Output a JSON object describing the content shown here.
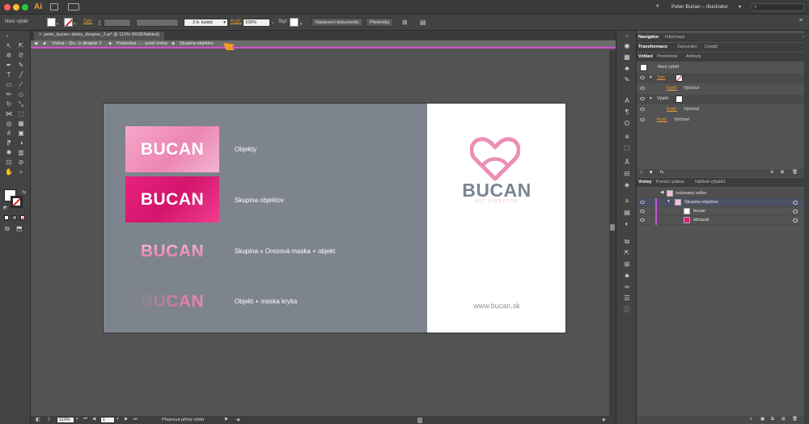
{
  "app": {
    "name": "Ai",
    "title": "Peter Bučan – Illustrator",
    "search_placeholder": ""
  },
  "control_bar": {
    "selection": "Není výběr",
    "stroke_label": "Tah:",
    "brush": "3 b. kulatý",
    "opacity_label": "Krytí:",
    "opacity_value": "100%",
    "style_label": "Styl:",
    "doc_setup_button": "Nastavení dokumentu",
    "prefs_button": "Předvolby"
  },
  "document": {
    "tab_title": "peter_bucan--dobry_dizajner_2.ai* @ 110% (RGB/Náhled)",
    "breadcrumb": [
      "Vrstva – Do...b dizajnér 2",
      "Podvrstva –... avod vrstvy",
      "Skupina objektov"
    ]
  },
  "artboard": {
    "rows": [
      {
        "logo_text": "BUCAN",
        "label": "Objekty"
      },
      {
        "logo_text": "BUCAN",
        "label": "Skupina objektov"
      },
      {
        "logo_text": "BUCAN",
        "label": "Skupina » Orezová maska + objekt"
      },
      {
        "logo_text": "BUCAN",
        "label": "Objekt + maska krytia"
      }
    ],
    "brand_name": "BUCAN",
    "brand_tagline": "ART DIRECTOR",
    "brand_url": "www.bucan.sk"
  },
  "status_bar": {
    "zoom": "110%",
    "page": "1",
    "tool_hint": "Přepnout přímý výběr"
  },
  "panels": {
    "top_tabs": [
      "Navigátor",
      "Informace"
    ],
    "mid_tabs": [
      "Transformace",
      "Zarovnání",
      "Cestář"
    ],
    "appearance_tabs": [
      "Vzhled",
      "Proměnná",
      "Atributy"
    ],
    "appearance": {
      "header": "Není výběr",
      "stroke_label": "Tah:",
      "stroke_opacity_label": "Krytí:",
      "stroke_opacity_value": "Výchozí",
      "fill_label": "Výplň:",
      "fill_opacity_label": "Krytí:",
      "fill_opacity_value": "Výchozí",
      "opacity_label": "Krytí:",
      "opacity_value": "Výchozí"
    },
    "layers_tabs": [
      "Vrstvy",
      "Kreslicí plátna",
      "Náhled výtažků"
    ],
    "layers": [
      {
        "name": "Izolovaný režim"
      },
      {
        "name": "Skupina objektov"
      },
      {
        "name": "bucan"
      },
      {
        "name": "obrazok"
      }
    ]
  },
  "colors": {
    "accent_pink": "#e4187a",
    "light_pink": "#f08fb9",
    "brand_gray": "#7b8591",
    "isolation_magenta": "#d24fd6",
    "orange_arrow": "#f39a2b"
  }
}
